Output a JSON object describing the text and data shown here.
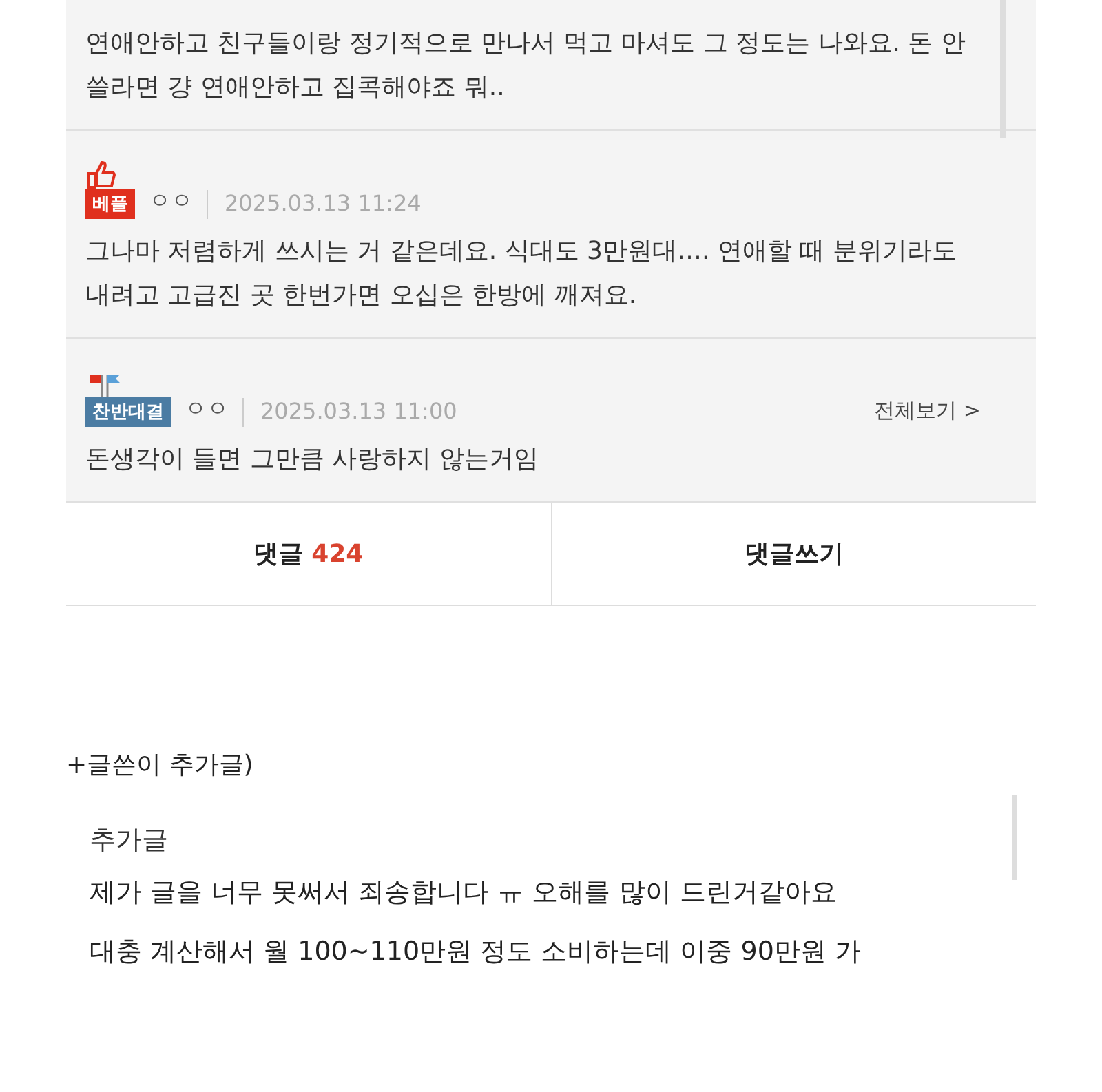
{
  "comments": [
    {
      "text": "연애안하고 친구들이랑 정기적으로 만나서 먹고 마셔도 그 정도는 나와요. 돈 안쓸라면 걍 연애안하고 집콕해야죠 뭐.."
    },
    {
      "badge": {
        "kind": "best",
        "label": "베플"
      },
      "author": "ㅇㅇ",
      "date": "2025.03.13 11:24",
      "text": "그나마 저렴하게 쓰시는 거 같은데요. 식대도 3만원대…. 연애할 때 분위기라도 내려고 고급진 곳 한번가면 오십은 한방에 깨져요."
    },
    {
      "badge": {
        "kind": "debate",
        "label": "찬반대결"
      },
      "author": "ㅇㅇ",
      "date": "2025.03.13 11:00",
      "more": "전체보기 >",
      "text": "돈생각이 들면 그만큼 사랑하지 않는거임"
    }
  ],
  "actions": {
    "comments_label": "댓글",
    "comments_count": "424",
    "write": "댓글쓰기"
  },
  "addendum": {
    "heading": "+글쓴이 추가글)",
    "title": "추가글",
    "lines": [
      "제가 글을 너무 못써서 죄송합니다 ㅠ 오해를 많이 드린거같아요",
      "대충 계산해서 월 100~110만원 정도 소비하는데 이중 90만원 가"
    ]
  }
}
